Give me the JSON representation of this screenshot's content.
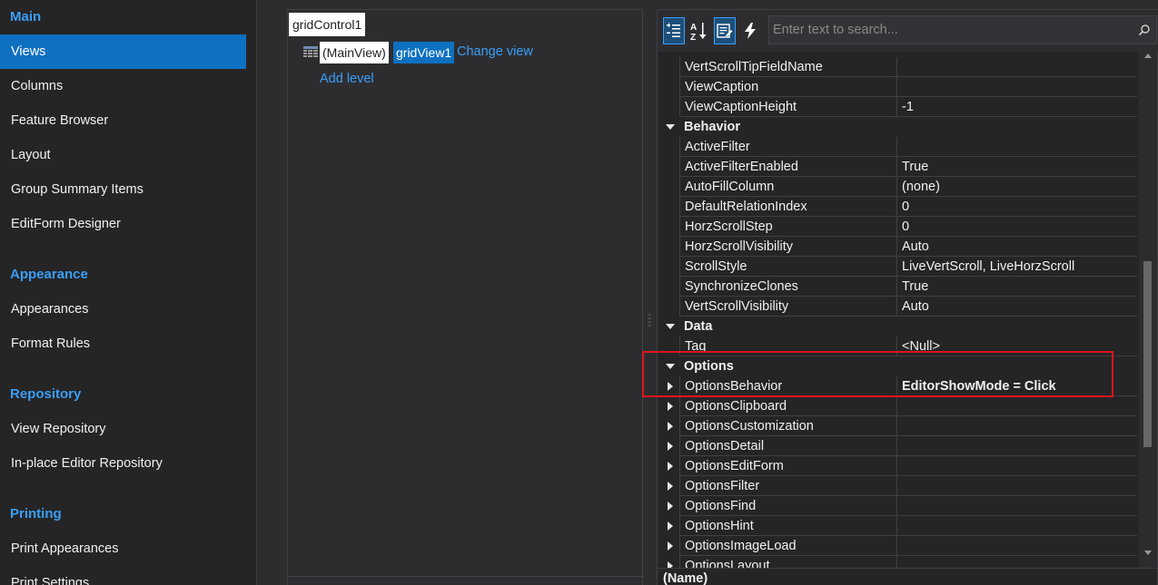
{
  "nav": {
    "sections": [
      {
        "header": "Main",
        "items": [
          "Views",
          "Columns",
          "Feature Browser",
          "Layout",
          "Group Summary Items",
          "EditForm Designer"
        ]
      },
      {
        "header": "Appearance",
        "items": [
          "Appearances",
          "Format Rules"
        ]
      },
      {
        "header": "Repository",
        "items": [
          "View Repository",
          "In-place Editor Repository"
        ]
      },
      {
        "header": "Printing",
        "items": [
          "Print Appearances",
          "Print Settings"
        ]
      }
    ],
    "active_item": "Views"
  },
  "designer": {
    "grid_control": "gridControl1",
    "main_view": "(MainView)",
    "view_name": "gridView1",
    "change_view_link": "Change view",
    "add_level_link": "Add level"
  },
  "property_grid": {
    "search_placeholder": "Enter text to search...",
    "toolbar": {
      "categorized_icon": "categorized-icon",
      "alphabetical_icon": "sort-az-icon",
      "properties_icon": "properties-icon",
      "events_icon": "lightning-icon"
    },
    "rows": [
      {
        "kind": "prop",
        "name": "VertScrollTipFieldName",
        "value": ""
      },
      {
        "kind": "prop",
        "name": "ViewCaption",
        "value": ""
      },
      {
        "kind": "prop",
        "name": "ViewCaptionHeight",
        "value": "-1"
      },
      {
        "kind": "category",
        "name": "Behavior"
      },
      {
        "kind": "prop",
        "name": "ActiveFilter",
        "value": ""
      },
      {
        "kind": "prop",
        "name": "ActiveFilterEnabled",
        "value": "True"
      },
      {
        "kind": "prop",
        "name": "AutoFillColumn",
        "value": "(none)"
      },
      {
        "kind": "prop",
        "name": "DefaultRelationIndex",
        "value": "0"
      },
      {
        "kind": "prop",
        "name": "HorzScrollStep",
        "value": "0"
      },
      {
        "kind": "prop",
        "name": "HorzScrollVisibility",
        "value": "Auto"
      },
      {
        "kind": "prop",
        "name": "ScrollStyle",
        "value": "LiveVertScroll, LiveHorzScroll"
      },
      {
        "kind": "prop",
        "name": "SynchronizeClones",
        "value": "True"
      },
      {
        "kind": "prop",
        "name": "VertScrollVisibility",
        "value": "Auto"
      },
      {
        "kind": "category",
        "name": "Data"
      },
      {
        "kind": "prop",
        "name": "Tag",
        "value": "<Null>"
      },
      {
        "kind": "category",
        "name": "Options"
      },
      {
        "kind": "expandable",
        "name": "OptionsBehavior",
        "value": "EditorShowMode = Click",
        "bold": true
      },
      {
        "kind": "expandable",
        "name": "OptionsClipboard",
        "value": ""
      },
      {
        "kind": "expandable",
        "name": "OptionsCustomization",
        "value": ""
      },
      {
        "kind": "expandable",
        "name": "OptionsDetail",
        "value": ""
      },
      {
        "kind": "expandable",
        "name": "OptionsEditForm",
        "value": ""
      },
      {
        "kind": "expandable",
        "name": "OptionsFilter",
        "value": ""
      },
      {
        "kind": "expandable",
        "name": "OptionsFind",
        "value": ""
      },
      {
        "kind": "expandable",
        "name": "OptionsHint",
        "value": ""
      },
      {
        "kind": "expandable",
        "name": "OptionsImageLoad",
        "value": ""
      },
      {
        "kind": "expandable",
        "name": "OptionsLayout",
        "value": ""
      }
    ],
    "description_title": "(Name)"
  },
  "colors": {
    "accent": "#0e70c0",
    "link": "#3a9ef6",
    "highlight": "#e0141e"
  }
}
